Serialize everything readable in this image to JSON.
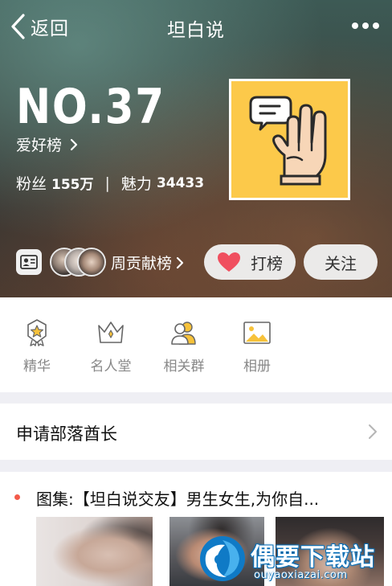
{
  "nav": {
    "back_label": "返回",
    "title": "坦白说"
  },
  "hero": {
    "rank": "NO.37",
    "category": "爱好榜",
    "fans_label": "粉丝",
    "fans_value": "155万",
    "separator": "|",
    "charm_label": "魅力",
    "charm_value": "34433",
    "weekly_contrib": "周贡献榜",
    "vote_label": "打榜",
    "follow_label": "关注"
  },
  "features": [
    {
      "label": "精华",
      "icon": "medal-icon"
    },
    {
      "label": "名人堂",
      "icon": "crown-icon"
    },
    {
      "label": "相关群",
      "icon": "group-icon"
    },
    {
      "label": "相册",
      "icon": "photo-icon"
    }
  ],
  "apply": {
    "label": "申请部落酋长"
  },
  "post": {
    "title": "图集:【坦白说交友】男生女生,为你自..."
  },
  "watermark": {
    "name": "偶要下载站",
    "url": "ouyaoxiazai.com"
  },
  "colors": {
    "accent_red": "#f35a4a",
    "avatar_bg": "#fcc94a",
    "heart": "#f04f5f"
  }
}
